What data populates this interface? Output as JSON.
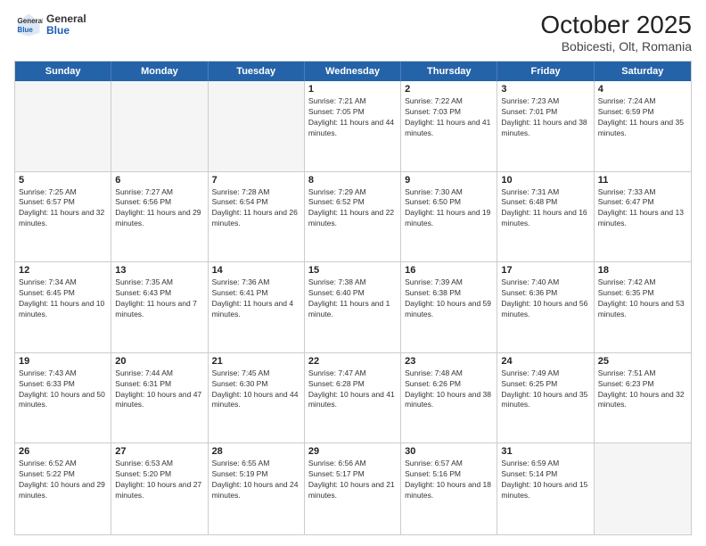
{
  "header": {
    "logo_general": "General",
    "logo_blue": "Blue",
    "title": "October 2025",
    "subtitle": "Bobicesti, Olt, Romania"
  },
  "days": [
    "Sunday",
    "Monday",
    "Tuesday",
    "Wednesday",
    "Thursday",
    "Friday",
    "Saturday"
  ],
  "weeks": [
    [
      {
        "num": "",
        "sunrise": "",
        "sunset": "",
        "daylight": "",
        "empty": true
      },
      {
        "num": "",
        "sunrise": "",
        "sunset": "",
        "daylight": "",
        "empty": true
      },
      {
        "num": "",
        "sunrise": "",
        "sunset": "",
        "daylight": "",
        "empty": true
      },
      {
        "num": "1",
        "sunrise": "Sunrise: 7:21 AM",
        "sunset": "Sunset: 7:05 PM",
        "daylight": "Daylight: 11 hours and 44 minutes.",
        "empty": false
      },
      {
        "num": "2",
        "sunrise": "Sunrise: 7:22 AM",
        "sunset": "Sunset: 7:03 PM",
        "daylight": "Daylight: 11 hours and 41 minutes.",
        "empty": false
      },
      {
        "num": "3",
        "sunrise": "Sunrise: 7:23 AM",
        "sunset": "Sunset: 7:01 PM",
        "daylight": "Daylight: 11 hours and 38 minutes.",
        "empty": false
      },
      {
        "num": "4",
        "sunrise": "Sunrise: 7:24 AM",
        "sunset": "Sunset: 6:59 PM",
        "daylight": "Daylight: 11 hours and 35 minutes.",
        "empty": false
      }
    ],
    [
      {
        "num": "5",
        "sunrise": "Sunrise: 7:25 AM",
        "sunset": "Sunset: 6:57 PM",
        "daylight": "Daylight: 11 hours and 32 minutes.",
        "empty": false
      },
      {
        "num": "6",
        "sunrise": "Sunrise: 7:27 AM",
        "sunset": "Sunset: 6:56 PM",
        "daylight": "Daylight: 11 hours and 29 minutes.",
        "empty": false
      },
      {
        "num": "7",
        "sunrise": "Sunrise: 7:28 AM",
        "sunset": "Sunset: 6:54 PM",
        "daylight": "Daylight: 11 hours and 26 minutes.",
        "empty": false
      },
      {
        "num": "8",
        "sunrise": "Sunrise: 7:29 AM",
        "sunset": "Sunset: 6:52 PM",
        "daylight": "Daylight: 11 hours and 22 minutes.",
        "empty": false
      },
      {
        "num": "9",
        "sunrise": "Sunrise: 7:30 AM",
        "sunset": "Sunset: 6:50 PM",
        "daylight": "Daylight: 11 hours and 19 minutes.",
        "empty": false
      },
      {
        "num": "10",
        "sunrise": "Sunrise: 7:31 AM",
        "sunset": "Sunset: 6:48 PM",
        "daylight": "Daylight: 11 hours and 16 minutes.",
        "empty": false
      },
      {
        "num": "11",
        "sunrise": "Sunrise: 7:33 AM",
        "sunset": "Sunset: 6:47 PM",
        "daylight": "Daylight: 11 hours and 13 minutes.",
        "empty": false
      }
    ],
    [
      {
        "num": "12",
        "sunrise": "Sunrise: 7:34 AM",
        "sunset": "Sunset: 6:45 PM",
        "daylight": "Daylight: 11 hours and 10 minutes.",
        "empty": false
      },
      {
        "num": "13",
        "sunrise": "Sunrise: 7:35 AM",
        "sunset": "Sunset: 6:43 PM",
        "daylight": "Daylight: 11 hours and 7 minutes.",
        "empty": false
      },
      {
        "num": "14",
        "sunrise": "Sunrise: 7:36 AM",
        "sunset": "Sunset: 6:41 PM",
        "daylight": "Daylight: 11 hours and 4 minutes.",
        "empty": false
      },
      {
        "num": "15",
        "sunrise": "Sunrise: 7:38 AM",
        "sunset": "Sunset: 6:40 PM",
        "daylight": "Daylight: 11 hours and 1 minute.",
        "empty": false
      },
      {
        "num": "16",
        "sunrise": "Sunrise: 7:39 AM",
        "sunset": "Sunset: 6:38 PM",
        "daylight": "Daylight: 10 hours and 59 minutes.",
        "empty": false
      },
      {
        "num": "17",
        "sunrise": "Sunrise: 7:40 AM",
        "sunset": "Sunset: 6:36 PM",
        "daylight": "Daylight: 10 hours and 56 minutes.",
        "empty": false
      },
      {
        "num": "18",
        "sunrise": "Sunrise: 7:42 AM",
        "sunset": "Sunset: 6:35 PM",
        "daylight": "Daylight: 10 hours and 53 minutes.",
        "empty": false
      }
    ],
    [
      {
        "num": "19",
        "sunrise": "Sunrise: 7:43 AM",
        "sunset": "Sunset: 6:33 PM",
        "daylight": "Daylight: 10 hours and 50 minutes.",
        "empty": false
      },
      {
        "num": "20",
        "sunrise": "Sunrise: 7:44 AM",
        "sunset": "Sunset: 6:31 PM",
        "daylight": "Daylight: 10 hours and 47 minutes.",
        "empty": false
      },
      {
        "num": "21",
        "sunrise": "Sunrise: 7:45 AM",
        "sunset": "Sunset: 6:30 PM",
        "daylight": "Daylight: 10 hours and 44 minutes.",
        "empty": false
      },
      {
        "num": "22",
        "sunrise": "Sunrise: 7:47 AM",
        "sunset": "Sunset: 6:28 PM",
        "daylight": "Daylight: 10 hours and 41 minutes.",
        "empty": false
      },
      {
        "num": "23",
        "sunrise": "Sunrise: 7:48 AM",
        "sunset": "Sunset: 6:26 PM",
        "daylight": "Daylight: 10 hours and 38 minutes.",
        "empty": false
      },
      {
        "num": "24",
        "sunrise": "Sunrise: 7:49 AM",
        "sunset": "Sunset: 6:25 PM",
        "daylight": "Daylight: 10 hours and 35 minutes.",
        "empty": false
      },
      {
        "num": "25",
        "sunrise": "Sunrise: 7:51 AM",
        "sunset": "Sunset: 6:23 PM",
        "daylight": "Daylight: 10 hours and 32 minutes.",
        "empty": false
      }
    ],
    [
      {
        "num": "26",
        "sunrise": "Sunrise: 6:52 AM",
        "sunset": "Sunset: 5:22 PM",
        "daylight": "Daylight: 10 hours and 29 minutes.",
        "empty": false
      },
      {
        "num": "27",
        "sunrise": "Sunrise: 6:53 AM",
        "sunset": "Sunset: 5:20 PM",
        "daylight": "Daylight: 10 hours and 27 minutes.",
        "empty": false
      },
      {
        "num": "28",
        "sunrise": "Sunrise: 6:55 AM",
        "sunset": "Sunset: 5:19 PM",
        "daylight": "Daylight: 10 hours and 24 minutes.",
        "empty": false
      },
      {
        "num": "29",
        "sunrise": "Sunrise: 6:56 AM",
        "sunset": "Sunset: 5:17 PM",
        "daylight": "Daylight: 10 hours and 21 minutes.",
        "empty": false
      },
      {
        "num": "30",
        "sunrise": "Sunrise: 6:57 AM",
        "sunset": "Sunset: 5:16 PM",
        "daylight": "Daylight: 10 hours and 18 minutes.",
        "empty": false
      },
      {
        "num": "31",
        "sunrise": "Sunrise: 6:59 AM",
        "sunset": "Sunset: 5:14 PM",
        "daylight": "Daylight: 10 hours and 15 minutes.",
        "empty": false
      },
      {
        "num": "",
        "sunrise": "",
        "sunset": "",
        "daylight": "",
        "empty": true
      }
    ]
  ]
}
